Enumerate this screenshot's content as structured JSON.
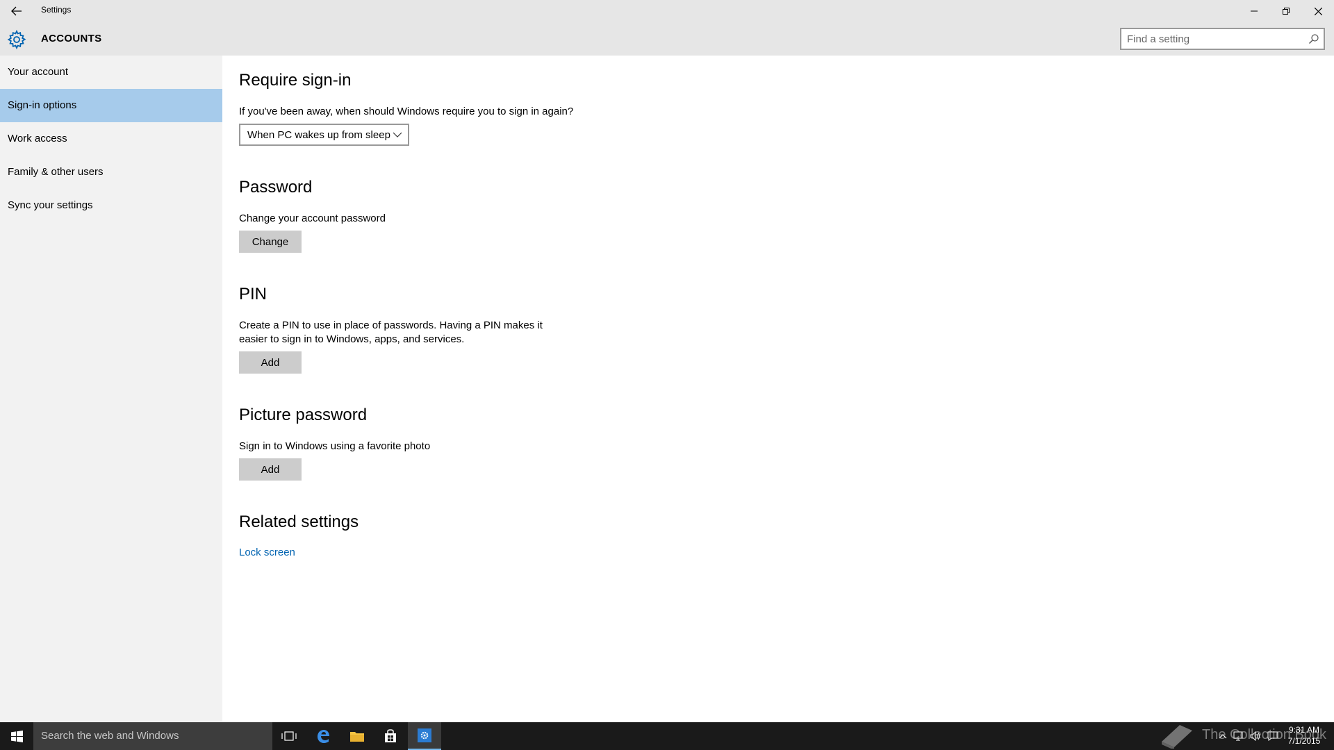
{
  "window": {
    "title": "Settings",
    "section": "ACCOUNTS",
    "search_placeholder": "Find a setting"
  },
  "sidebar": {
    "items": [
      {
        "label": "Your account"
      },
      {
        "label": "Sign-in options",
        "active": true
      },
      {
        "label": "Work access"
      },
      {
        "label": "Family & other users"
      },
      {
        "label": "Sync your settings"
      }
    ]
  },
  "main": {
    "require_signin": {
      "heading": "Require sign-in",
      "question": "If you've been away, when should Windows require you to sign in again?",
      "selected_option": "When PC wakes up from sleep"
    },
    "password": {
      "heading": "Password",
      "description": "Change your account password",
      "button": "Change"
    },
    "pin": {
      "heading": "PIN",
      "description_line1": "Create a PIN to use in place of passwords. Having a PIN makes it",
      "description_line2": "easier to sign in to Windows, apps, and services.",
      "button": "Add"
    },
    "picture_password": {
      "heading": "Picture password",
      "description": "Sign in to Windows using a favorite photo",
      "button": "Add"
    },
    "related": {
      "heading": "Related settings",
      "link": "Lock screen"
    }
  },
  "taskbar": {
    "search_text": "Search the web and Windows",
    "time": "9:31 AM",
    "date": "7/1/2015",
    "watermark": "The Collection Book"
  },
  "colors": {
    "accent": "#0063b1",
    "sidebar_active": "#a6cbeb",
    "titlebar": "#e6e6e6",
    "sidebar": "#f2f2f2",
    "button": "#cccccc",
    "taskbar": "#1a1a1a"
  }
}
